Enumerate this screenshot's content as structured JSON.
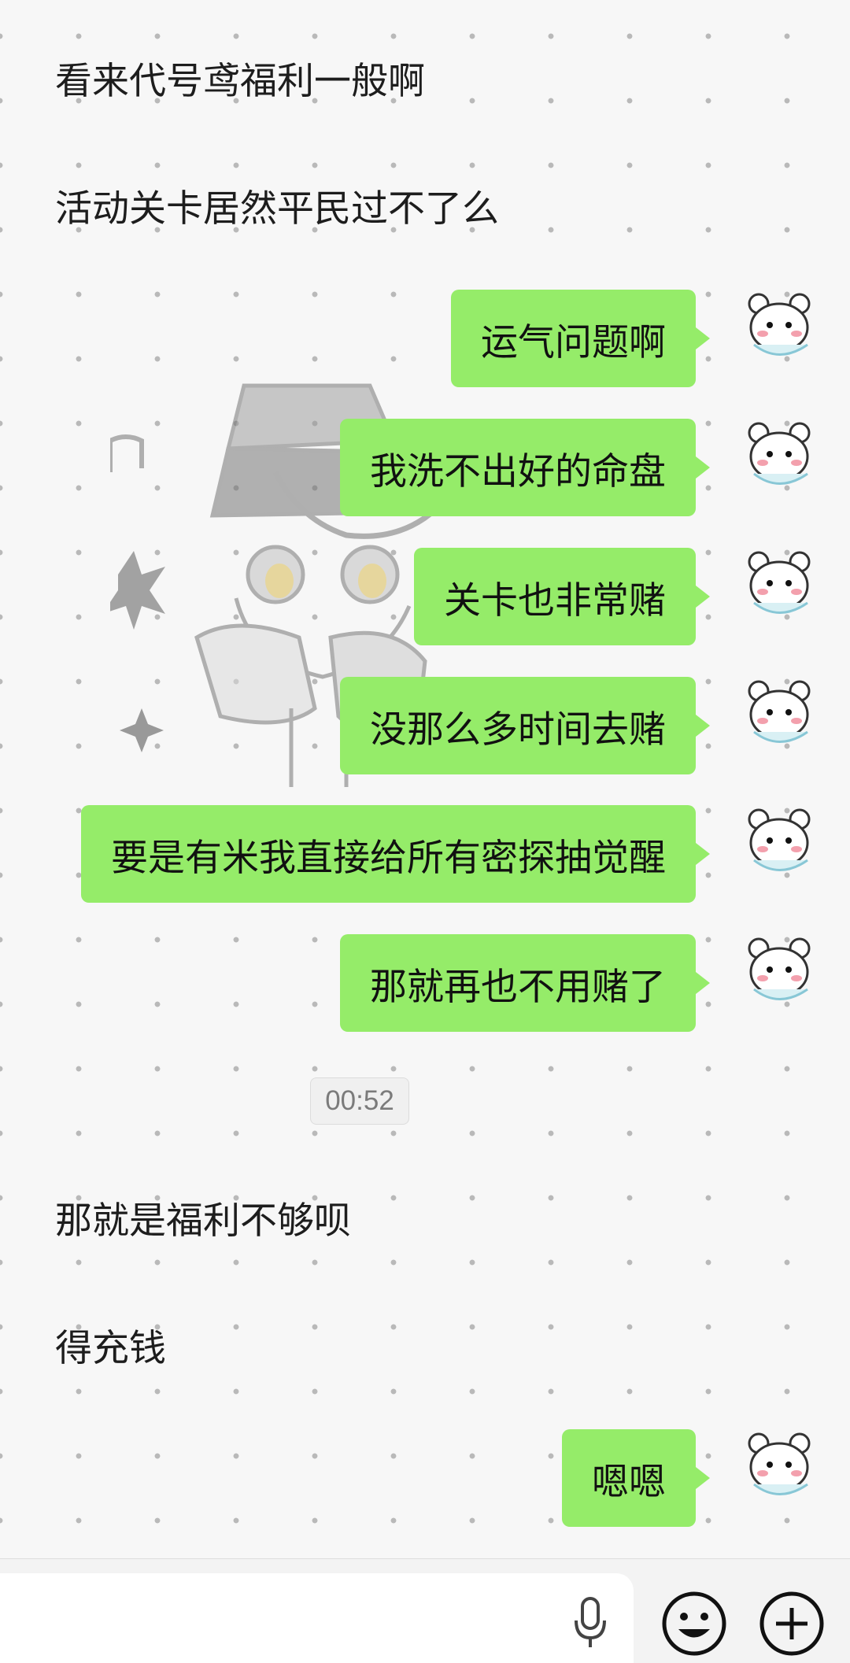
{
  "messages": [
    {
      "side": "incoming",
      "text": "看来代号鸢福利一般啊"
    },
    {
      "side": "incoming",
      "text": "活动关卡居然平民过不了么"
    },
    {
      "side": "outgoing",
      "text": "运气问题啊"
    },
    {
      "side": "outgoing",
      "text": "我洗不出好的命盘"
    },
    {
      "side": "outgoing",
      "text": "关卡也非常赌"
    },
    {
      "side": "outgoing",
      "text": "没那么多时间去赌"
    },
    {
      "side": "outgoing",
      "text": "要是有米我直接给所有密探抽觉醒"
    },
    {
      "side": "outgoing",
      "text": "那就再也不用赌了"
    },
    {
      "side": "timestamp",
      "text": "00:52"
    },
    {
      "side": "incoming",
      "text": "那就是福利不够呗"
    },
    {
      "side": "incoming",
      "text": "得充钱"
    },
    {
      "side": "outgoing",
      "text": "嗯嗯"
    }
  ],
  "input_bar": {
    "icons": [
      "microphone-icon",
      "emoji-icon",
      "plus-icon"
    ]
  },
  "colors": {
    "outgoing_bubble": "#95ec69",
    "background": "#f7f7f7"
  }
}
